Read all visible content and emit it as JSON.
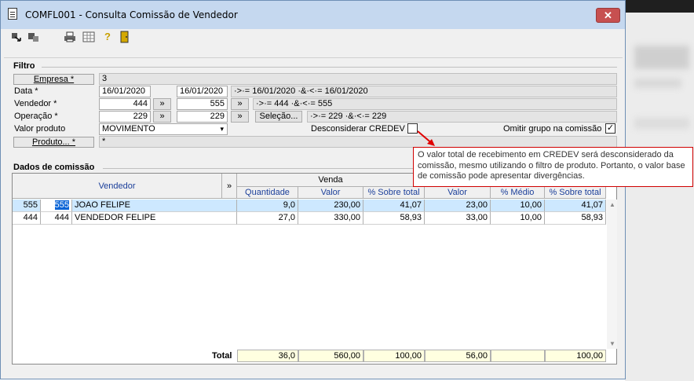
{
  "window": {
    "title": "COMFL001 - Consulta Comissão de Vendedor",
    "close_label": "✕"
  },
  "toolbar": {
    "icons": [
      "exit-icon",
      "filter-icon",
      "print-icon",
      "grid-icon",
      "help-icon",
      "door-icon"
    ]
  },
  "filter": {
    "group_title": "Filtro",
    "empresa_label": "Empresa *",
    "empresa_value": "3",
    "data_label": "Data *",
    "data_from": "16/01/2020",
    "data_to": "16/01/2020",
    "data_expr": "·>·= 16/01/2020 ·&·<·= 16/01/2020",
    "vendedor_label": "Vendedor *",
    "vendedor_from": "444",
    "vendedor_to": "555",
    "vendedor_expr": "·>·= 444 ·&·<·= 555",
    "operacao_label": "Operação *",
    "operacao_from": "229",
    "operacao_to": "229",
    "operacao_selecao": "Seleção...",
    "operacao_expr": "·>·= 229 ·&·<·= 229",
    "range_button": "»",
    "valor_produto_label": "Valor produto",
    "valor_produto_value": "MOVIMENTO",
    "desconsiderar_label": "Desconsiderar CREDEV",
    "desconsiderar_checked": false,
    "omitir_label": "Omitir grupo na comissão",
    "omitir_checked": true,
    "produto_label": "Produto... *",
    "produto_value": "*"
  },
  "tooltip": {
    "text": "O valor total de recebimento em CREDEV será desconsiderado da comissão, mesmo utilizando o filtro de produto. Portanto, o valor base de comissão pode apresentar divergências."
  },
  "comissao": {
    "group_title": "Dados de comissão",
    "vendedor_header": "Vendedor",
    "expand_header": "»",
    "venda_header": "Venda",
    "columns": [
      "Quantidade",
      "Valor",
      "% Sobre total",
      "Valor",
      "% Médio",
      "% Sobre total"
    ],
    "rows": [
      {
        "cod1": "555",
        "cod2": "555",
        "nome": "JOAO FELIPE",
        "quantidade": "9,0",
        "valor": "230,00",
        "sobre_total": "41,07",
        "valor2": "23,00",
        "medio": "10,00",
        "sobre_total2": "41,07"
      },
      {
        "cod1": "444",
        "cod2": "444",
        "nome": "VENDEDOR FELIPE",
        "quantidade": "27,0",
        "valor": "330,00",
        "sobre_total": "58,93",
        "valor2": "33,00",
        "medio": "10,00",
        "sobre_total2": "58,93"
      }
    ],
    "total_label": "Total",
    "totals": {
      "quantidade": "36,0",
      "valor": "560,00",
      "sobre_total": "100,00",
      "valor2": "56,00",
      "medio": "",
      "sobre_total2": "100,00"
    }
  }
}
